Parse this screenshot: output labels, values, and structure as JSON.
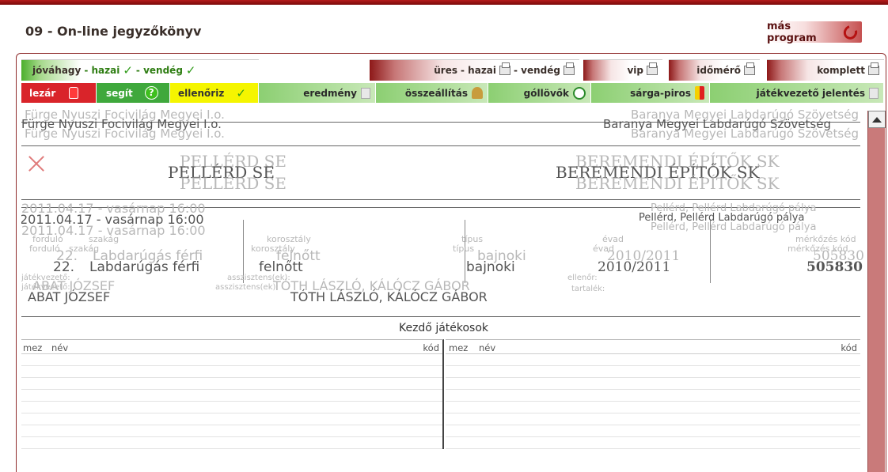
{
  "header": {
    "title": "09 - On-line jegyzőkönyv",
    "more_program": "más program"
  },
  "row1": {
    "approve": {
      "label": "jóváhagy",
      "home": "- hazai",
      "away": "- vendég"
    },
    "empty": {
      "label": "üres",
      "home": "- hazai",
      "away": "- vendég"
    },
    "vip": "vip",
    "timekeeper": "időmérő",
    "complete": "komplett"
  },
  "row2": {
    "lock": "lezár",
    "help": "segít",
    "check": "ellenőriz",
    "result": "eredmény",
    "lineup": "összeállítás",
    "scorers": "góllövők",
    "cards": "sárga-piros",
    "referee_report": "játékvezető jelentés"
  },
  "match": {
    "league_left": "Fürge Nyuszi Focivilág Megyei I.o.",
    "league_right": "Baranya Megyei Labdarúgó Szövetség",
    "home_team": "PELLÉRD SE",
    "away_team": "BEREMENDI ÉPÍTŐK SK",
    "date": "2011.04.17 - vasárnap 16:00",
    "venue": "Pellérd, Pellérd Labdarúgó pálya",
    "round_label": "forduló",
    "class_label": "szakág",
    "round_value": "22.",
    "class_value": "Labdarúgás férfi",
    "age_label": "korosztály",
    "age_value": "felnőtt",
    "type_label": "típus",
    "type_value": "bajnoki",
    "season_label": "évad",
    "season_value": "2010/2011",
    "match_code_label": "mérkőzés kód",
    "match_code": "505830",
    "referee_label": "játékvezető:",
    "referee_value": "ABAT JÓZSEF",
    "assistants_label": "asszisztens(ek):",
    "assistants_value": "TÓTH LÁSZLÓ, KÁLÓCZ GÁBOR",
    "supervisor_label": "ellenőr:",
    "reserve_label": "tartalék:"
  },
  "starters": {
    "title": "Kezdő játékosok",
    "col_shirt": "mez",
    "col_name": "név",
    "col_code": "kód"
  }
}
